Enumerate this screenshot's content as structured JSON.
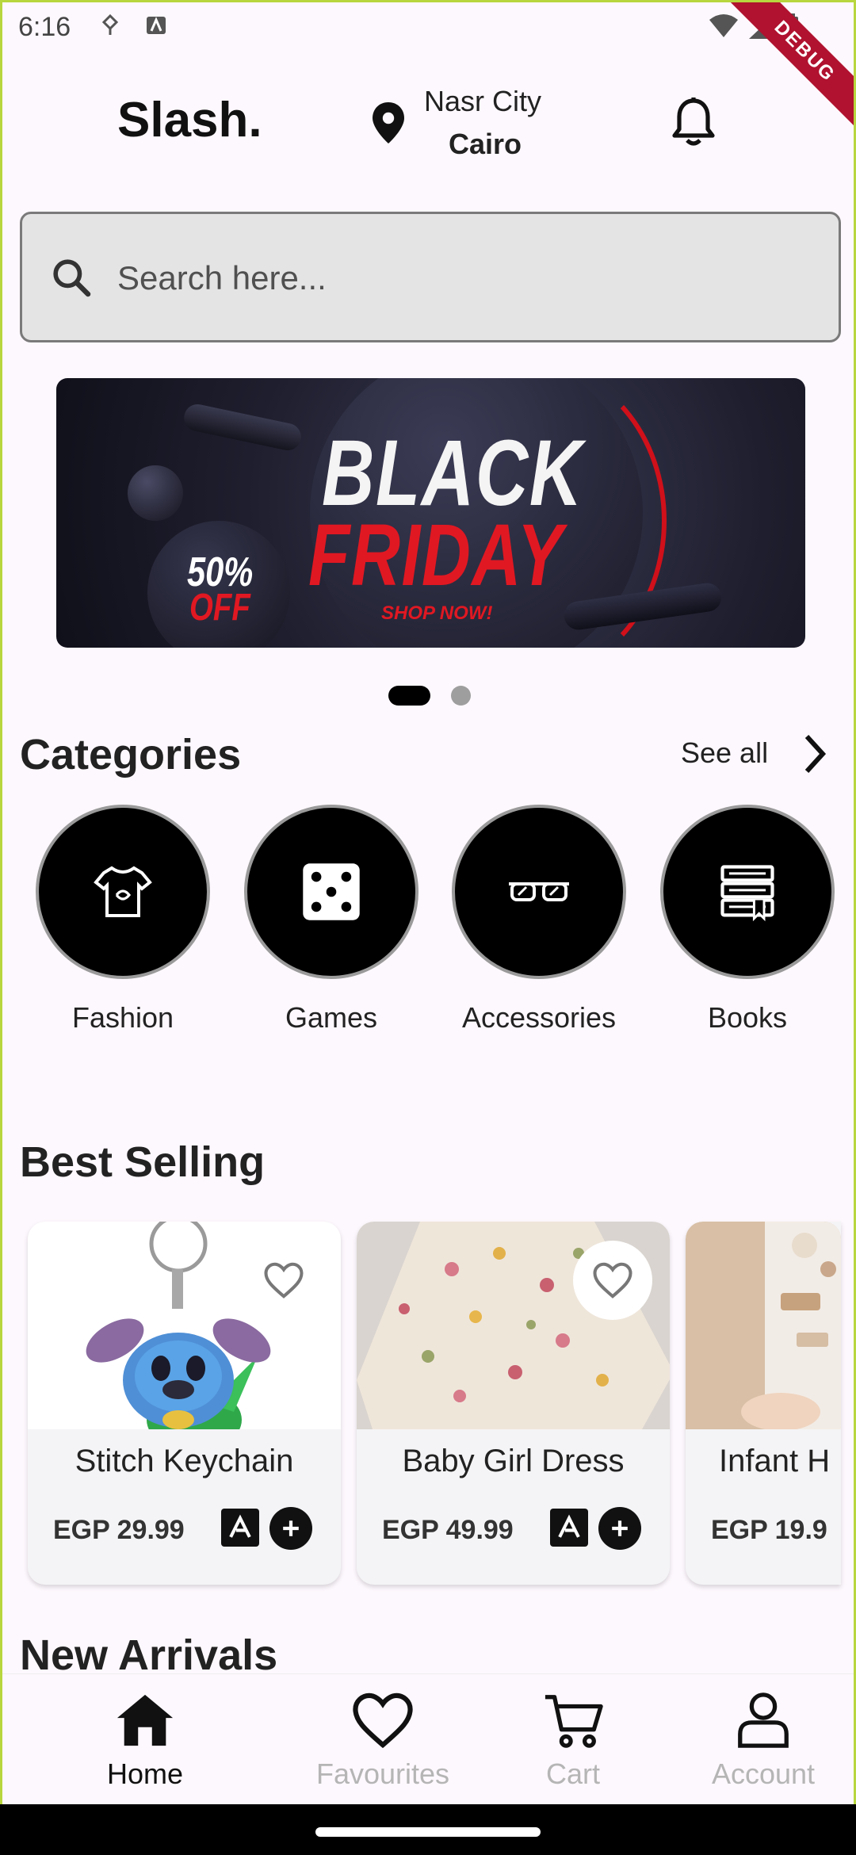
{
  "status_bar": {
    "time": "6:16",
    "debug_label": "DEBUG"
  },
  "header": {
    "brand": "Slash.",
    "location": {
      "area": "Nasr City",
      "city": "Cairo"
    }
  },
  "search": {
    "placeholder": "Search here..."
  },
  "banner": {
    "line1": "BLACK",
    "line2": "FRIDAY",
    "cta": "SHOP NOW!",
    "discount_pct": "50%",
    "discount_off": "OFF",
    "slide_count": 2,
    "active_slide": 1
  },
  "categories": {
    "title": "Categories",
    "see_all": "See all",
    "items": [
      {
        "label": "Fashion",
        "icon": "tshirt-icon"
      },
      {
        "label": "Games",
        "icon": "dice-icon"
      },
      {
        "label": "Accessories",
        "icon": "glasses-icon"
      },
      {
        "label": "Books",
        "icon": "books-icon"
      }
    ]
  },
  "best_selling": {
    "title": "Best Selling",
    "products": [
      {
        "name": "Stitch Keychain",
        "price": "EGP 29.99"
      },
      {
        "name": "Baby Girl Dress",
        "price": "EGP 49.99"
      },
      {
        "name": "Infant H",
        "price": "EGP 19.9"
      }
    ]
  },
  "new_arrivals": {
    "title": "New Arrivals"
  },
  "bottom_nav": {
    "items": [
      {
        "label": "Home",
        "icon": "home-icon",
        "active": true
      },
      {
        "label": "Favourites",
        "icon": "heart-icon",
        "active": false
      },
      {
        "label": "Cart",
        "icon": "cart-icon",
        "active": false
      },
      {
        "label": "Account",
        "icon": "person-icon",
        "active": false
      }
    ]
  },
  "colors": {
    "background": "#fdf8fd",
    "primary": "#000000",
    "search_bg": "#e4e4e4",
    "accent_red": "#e01822",
    "inactive_nav": "#b5b5b5"
  }
}
